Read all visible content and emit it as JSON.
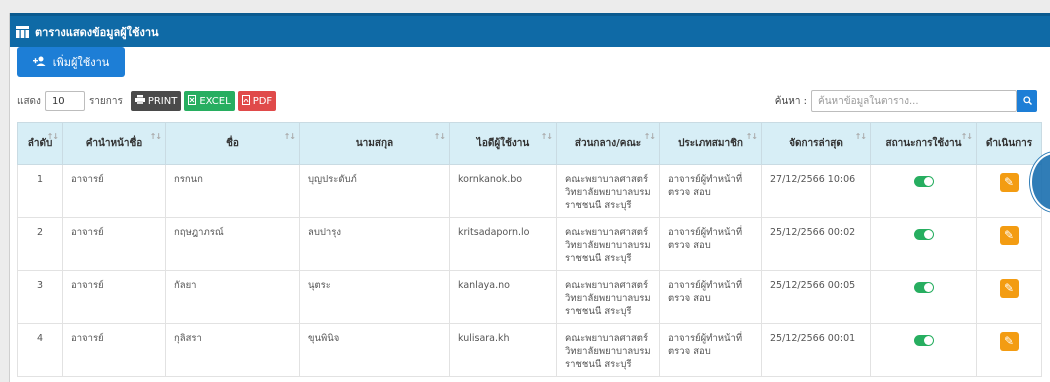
{
  "card": {
    "title": "ตารางแสดงข้อมูลผู้ใช้งาน"
  },
  "add_button": {
    "label": "เพิ่มผู้ใช้งาน"
  },
  "toolbar": {
    "show_label": "แสดง",
    "page_length": "10",
    "entries_label": "รายการ",
    "print_label": "PRINT",
    "excel_label": "EXCEL",
    "pdf_label": "PDF",
    "search_label": "ค้นหา :",
    "search_placeholder": "ค้นหาข้อมูลในตาราง..."
  },
  "table": {
    "headers": [
      "ลำดับ",
      "คำนำหน้าชื่อ",
      "ชื่อ",
      "นามสกุล",
      "ไอดีผู้ใช้งาน",
      "ส่วนกลาง/คณะ",
      "ประเภทสมาชิก",
      "จัดการล่าสุด",
      "สถานะการใช้งาน",
      "ดำเนินการ"
    ],
    "rows": [
      {
        "no": "1",
        "prefix": "อาจารย์",
        "first": "กรกนก",
        "last": "บุญประดับภ์",
        "user_id": "kornkanok.bo",
        "faculty": "คณะพยาบาลศาสตร์ วิทยาลัยพยาบาลบรม ราชชนนี สระบุรี",
        "member_type": "อาจารย์ผู้ทำหน้าที่ตรวจ สอบ",
        "last_action": "27/12/2566 10:06",
        "status": "on"
      },
      {
        "no": "2",
        "prefix": "อาจารย์",
        "first": "กฤษฎาภรณ์",
        "last": "ลบปารุง",
        "user_id": "kritsadaporn.lo",
        "faculty": "คณะพยาบาลศาสตร์ วิทยาลัยพยาบาลบรม ราชชนนี สระบุรี",
        "member_type": "อาจารย์ผู้ทำหน้าที่ตรวจ สอบ",
        "last_action": "25/12/2566 00:02",
        "status": "on"
      },
      {
        "no": "3",
        "prefix": "อาจารย์",
        "first": "กัลยา",
        "last": "นุตระ",
        "user_id": "kanlaya.no",
        "faculty": "คณะพยาบาลศาสตร์ วิทยาลัยพยาบาลบรม ราชชนนี สระบุรี",
        "member_type": "อาจารย์ผู้ทำหน้าที่ตรวจ สอบ",
        "last_action": "25/12/2566 00:05",
        "status": "on"
      },
      {
        "no": "4",
        "prefix": "อาจารย์",
        "first": "กุลิสรา",
        "last": "ขุนพินิจ",
        "user_id": "kulisara.kh",
        "faculty": "คณะพยาบาลศาสตร์ วิทยาลัยพยาบาลบรม ราชชนนี สระบุรี",
        "member_type": "อาจารย์ผู้ทำหน้าที่ตรวจ สอบ",
        "last_action": "25/12/2566 00:01",
        "status": "on"
      }
    ]
  },
  "colors": {
    "header_bar": "#0f6aa6",
    "primary": "#1d7ed6",
    "excel": "#27ae60",
    "pdf": "#e04a4a",
    "edit": "#f39c12",
    "thead": "#d7eef6"
  }
}
